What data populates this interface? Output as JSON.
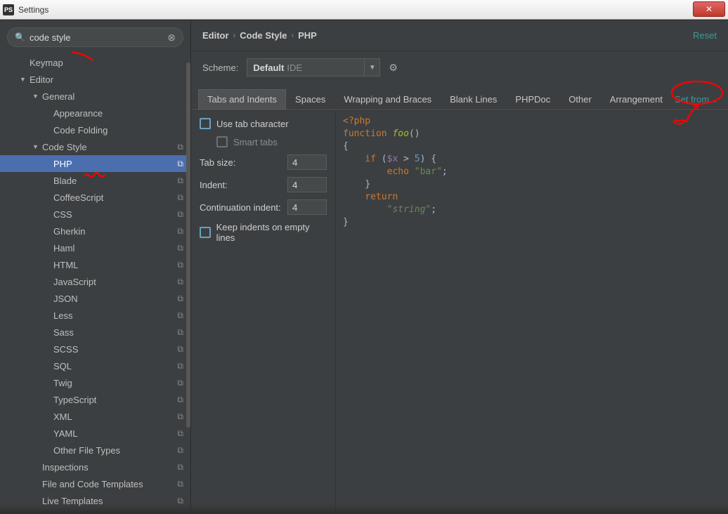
{
  "titlebar": {
    "app_badge": "PS",
    "title": "Settings",
    "close_glyph": "✕"
  },
  "sidebar": {
    "search": {
      "placeholder": "",
      "value": "code style"
    },
    "items": [
      {
        "label": "Keymap",
        "arrow": "",
        "indent": 1,
        "copy": false,
        "selected": false
      },
      {
        "label": "Editor",
        "arrow": "▼",
        "indent": 1,
        "copy": false,
        "selected": false
      },
      {
        "label": "General",
        "arrow": "▼",
        "indent": 2,
        "copy": false,
        "selected": false
      },
      {
        "label": "Appearance",
        "arrow": "",
        "indent": 3,
        "copy": false,
        "selected": false
      },
      {
        "label": "Code Folding",
        "arrow": "",
        "indent": 3,
        "copy": false,
        "selected": false
      },
      {
        "label": "Code Style",
        "arrow": "▼",
        "indent": 2,
        "copy": true,
        "selected": false
      },
      {
        "label": "PHP",
        "arrow": "",
        "indent": 3,
        "copy": true,
        "selected": true
      },
      {
        "label": "Blade",
        "arrow": "",
        "indent": 3,
        "copy": true,
        "selected": false
      },
      {
        "label": "CoffeeScript",
        "arrow": "",
        "indent": 3,
        "copy": true,
        "selected": false
      },
      {
        "label": "CSS",
        "arrow": "",
        "indent": 3,
        "copy": true,
        "selected": false
      },
      {
        "label": "Gherkin",
        "arrow": "",
        "indent": 3,
        "copy": true,
        "selected": false
      },
      {
        "label": "Haml",
        "arrow": "",
        "indent": 3,
        "copy": true,
        "selected": false
      },
      {
        "label": "HTML",
        "arrow": "",
        "indent": 3,
        "copy": true,
        "selected": false
      },
      {
        "label": "JavaScript",
        "arrow": "",
        "indent": 3,
        "copy": true,
        "selected": false
      },
      {
        "label": "JSON",
        "arrow": "",
        "indent": 3,
        "copy": true,
        "selected": false
      },
      {
        "label": "Less",
        "arrow": "",
        "indent": 3,
        "copy": true,
        "selected": false
      },
      {
        "label": "Sass",
        "arrow": "",
        "indent": 3,
        "copy": true,
        "selected": false
      },
      {
        "label": "SCSS",
        "arrow": "",
        "indent": 3,
        "copy": true,
        "selected": false
      },
      {
        "label": "SQL",
        "arrow": "",
        "indent": 3,
        "copy": true,
        "selected": false
      },
      {
        "label": "Twig",
        "arrow": "",
        "indent": 3,
        "copy": true,
        "selected": false
      },
      {
        "label": "TypeScript",
        "arrow": "",
        "indent": 3,
        "copy": true,
        "selected": false
      },
      {
        "label": "XML",
        "arrow": "",
        "indent": 3,
        "copy": true,
        "selected": false
      },
      {
        "label": "YAML",
        "arrow": "",
        "indent": 3,
        "copy": true,
        "selected": false
      },
      {
        "label": "Other File Types",
        "arrow": "",
        "indent": 3,
        "copy": true,
        "selected": false
      },
      {
        "label": "Inspections",
        "arrow": "",
        "indent": 2,
        "copy": true,
        "selected": false
      },
      {
        "label": "File and Code Templates",
        "arrow": "",
        "indent": 2,
        "copy": true,
        "selected": false
      },
      {
        "label": "Live Templates",
        "arrow": "",
        "indent": 2,
        "copy": true,
        "selected": false
      }
    ]
  },
  "breadcrumb": {
    "a": "Editor",
    "b": "Code Style",
    "c": "PHP",
    "reset": "Reset"
  },
  "scheme": {
    "label": "Scheme:",
    "value": "Default",
    "suffix": "IDE"
  },
  "tabs": {
    "items": [
      "Tabs and Indents",
      "Spaces",
      "Wrapping and Braces",
      "Blank Lines",
      "PHPDoc",
      "Other",
      "Arrangement"
    ],
    "active": 0,
    "setfrom": "Set from..."
  },
  "form": {
    "use_tab": "Use tab character",
    "smart_tabs": "Smart tabs",
    "tab_size_label": "Tab size:",
    "tab_size_value": "4",
    "indent_label": "Indent:",
    "indent_value": "4",
    "cont_label": "Continuation indent:",
    "cont_value": "4",
    "keep": "Keep indents on empty lines"
  },
  "code": {
    "l1_a": "<?php",
    "l2_a": "function",
    "l2_b": "foo",
    "l2_c": "()",
    "l3": "{",
    "l4_if": "if",
    "l4_var": "$x",
    "l4_op": ">",
    "l4_num": "5",
    "l4_tail": ") {",
    "l5_echo": "echo",
    "l5_str": "\"bar\"",
    "l5_semi": ";",
    "l6": "}",
    "l7": "return",
    "l8_str": "\"string\"",
    "l8_semi": ";",
    "l9": "}"
  }
}
